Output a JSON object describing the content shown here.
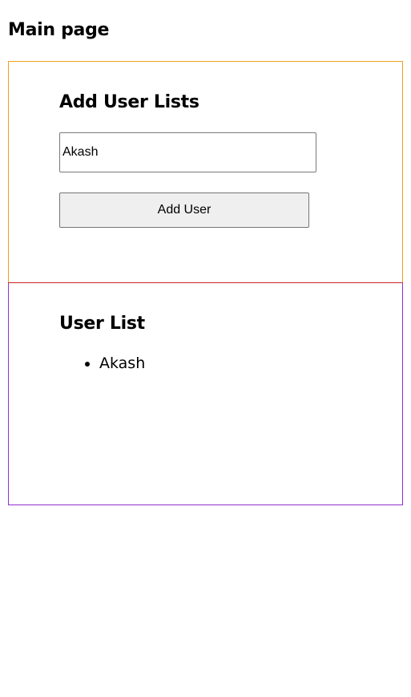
{
  "page": {
    "title": "Main page"
  },
  "add_user": {
    "title": "Add User Lists",
    "input_value": "Akash",
    "button_label": "Add User"
  },
  "user_list": {
    "title": "User List",
    "items": [
      "Akash"
    ]
  },
  "colors": {
    "add_panel_border": "#f0a020",
    "list_panel_border": "#9030d0",
    "divider": "#d02020"
  }
}
